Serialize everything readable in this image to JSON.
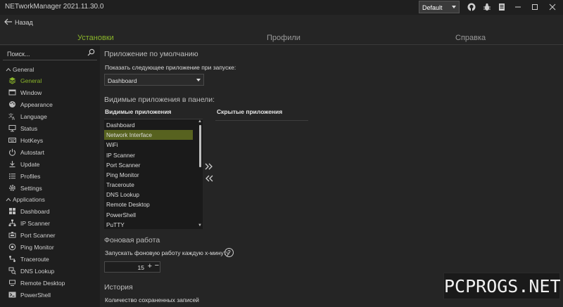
{
  "window": {
    "title": "NETworkManager 2021.11.30.0",
    "profile": "Default",
    "icons": [
      "github-icon",
      "bug-icon",
      "docs-icon",
      "settings-icon"
    ]
  },
  "nav": {
    "back_label": "Назад"
  },
  "tabs": [
    {
      "label": "Установки",
      "active": true
    },
    {
      "label": "Профили",
      "active": false
    },
    {
      "label": "Справка",
      "active": false
    }
  ],
  "sidebar": {
    "search_placeholder": "Поиск...",
    "group_general": "General",
    "group_applications": "Applications",
    "general_items": [
      {
        "label": "General",
        "icon": "layers-icon",
        "active": true
      },
      {
        "label": "Window",
        "icon": "window-icon"
      },
      {
        "label": "Appearance",
        "icon": "palette-icon"
      },
      {
        "label": "Language",
        "icon": "translate-icon"
      },
      {
        "label": "Status",
        "icon": "monitor-icon"
      },
      {
        "label": "HotKeys",
        "icon": "keyboard-icon"
      },
      {
        "label": "Autostart",
        "icon": "power-icon"
      },
      {
        "label": "Update",
        "icon": "download-icon"
      },
      {
        "label": "Profiles",
        "icon": "list-icon"
      },
      {
        "label": "Settings",
        "icon": "gear-icon"
      }
    ],
    "app_items": [
      {
        "label": "Dashboard",
        "icon": "dashboard-icon"
      },
      {
        "label": "IP Scanner",
        "icon": "network-icon"
      },
      {
        "label": "Port Scanner",
        "icon": "port-icon"
      },
      {
        "label": "Ping Monitor",
        "icon": "ping-icon"
      },
      {
        "label": "Traceroute",
        "icon": "route-icon"
      },
      {
        "label": "DNS Lookup",
        "icon": "dns-icon"
      },
      {
        "label": "Remote Desktop",
        "icon": "remote-icon"
      },
      {
        "label": "PowerShell",
        "icon": "terminal-icon"
      }
    ]
  },
  "main": {
    "default_app_heading": "Приложение по умолчанию",
    "startup_label": "Показать следующее приложение при запуске:",
    "startup_value": "Dashboard",
    "visible_heading": "Видимые приложения в панели:",
    "visible_col": "Видимые приложения",
    "hidden_col": "Скрытые приложения",
    "visible_apps": [
      {
        "label": "Dashboard",
        "selected": false
      },
      {
        "label": "Network Interface",
        "selected": true
      },
      {
        "label": "WiFi",
        "selected": false
      },
      {
        "label": "IP Scanner",
        "selected": false
      },
      {
        "label": "Port Scanner",
        "selected": false
      },
      {
        "label": "Ping Monitor",
        "selected": false
      },
      {
        "label": "Traceroute",
        "selected": false
      },
      {
        "label": "DNS Lookup",
        "selected": false
      },
      {
        "label": "Remote Desktop",
        "selected": false
      },
      {
        "label": "PowerShell",
        "selected": false
      },
      {
        "label": "PuTTY",
        "selected": false
      }
    ],
    "background_heading": "Фоновая работа",
    "background_label": "Запускать фоновую работу каждую x-минуту",
    "background_value": "15",
    "history_heading": "История",
    "history_label": "Количество сохраненных записей"
  },
  "watermark": "PCPROGS.NET",
  "colors": {
    "accent": "#8ab52a",
    "selection": "#57621f",
    "background": "#252525"
  }
}
